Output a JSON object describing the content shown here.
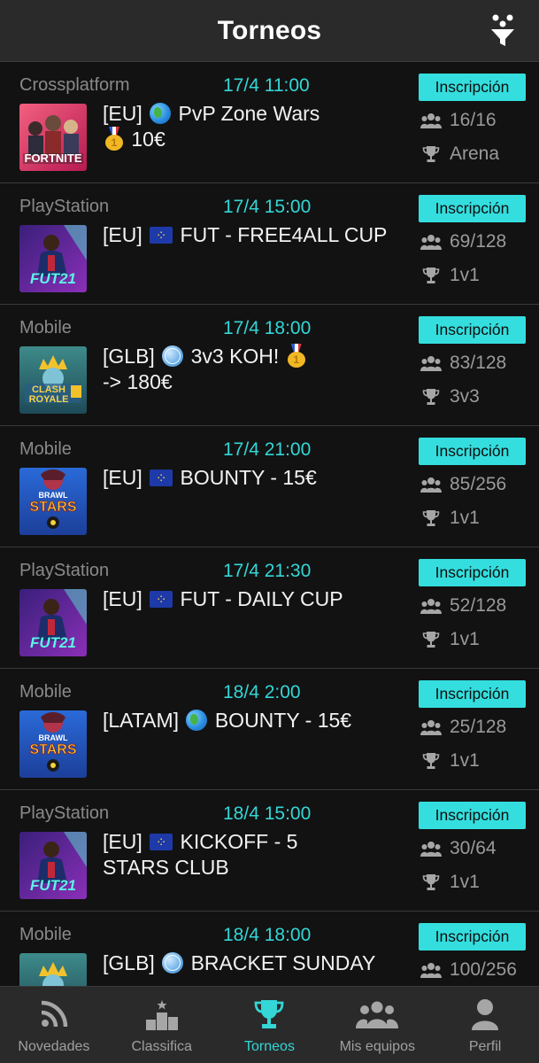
{
  "header": {
    "title": "Torneos"
  },
  "icons": {
    "filter": "filter-funnel-icon",
    "players": "group-icon",
    "format": "trophy-icon"
  },
  "colors": {
    "accent": "#34d6d6",
    "button_bg": "#34dede",
    "background": "#121212",
    "bar": "#2a2a2a"
  },
  "tournaments": [
    {
      "platform": "Crossplatform",
      "date": "17/4 11:00",
      "game": "Fortnite",
      "region": "[EU]",
      "flag": "world",
      "name": "PvP Zone Wars",
      "name2": "10€",
      "medal_end": false,
      "medal_line2": true,
      "button": "Inscripción",
      "players": "16/16",
      "format": "Arena"
    },
    {
      "platform": "PlayStation",
      "date": "17/4 15:00",
      "game": "FUT21",
      "region": "[EU]",
      "flag": "eu",
      "name": "FUT - FREE4ALL CUP",
      "name2": "",
      "medal_end": false,
      "medal_line2": false,
      "button": "Inscripción",
      "players": "69/128",
      "format": "1v1"
    },
    {
      "platform": "Mobile",
      "date": "17/4 18:00",
      "game": "Clash Royale",
      "region": "[GLB]",
      "flag": "grid",
      "name": "3v3 KOH!",
      "name2": "-> 180€",
      "medal_end": true,
      "medal_line2": false,
      "button": "Inscripción",
      "players": "83/128",
      "format": "3v3"
    },
    {
      "platform": "Mobile",
      "date": "17/4 21:00",
      "game": "Brawl Stars",
      "region": "[EU]",
      "flag": "eu",
      "name": "BOUNTY - 15€",
      "name2": "",
      "medal_end": false,
      "medal_line2": false,
      "button": "Inscripción",
      "players": "85/256",
      "format": "1v1"
    },
    {
      "platform": "PlayStation",
      "date": "17/4 21:30",
      "game": "FUT21",
      "region": "[EU]",
      "flag": "eu",
      "name": "FUT - DAILY CUP",
      "name2": "",
      "medal_end": false,
      "medal_line2": false,
      "button": "Inscripción",
      "players": "52/128",
      "format": "1v1"
    },
    {
      "platform": "Mobile",
      "date": "18/4 2:00",
      "game": "Brawl Stars",
      "region": "[LATAM]",
      "flag": "world",
      "name": "BOUNTY - 15€",
      "name2": "",
      "medal_end": false,
      "medal_line2": false,
      "button": "Inscripción",
      "players": "25/128",
      "format": "1v1"
    },
    {
      "platform": "PlayStation",
      "date": "18/4 15:00",
      "game": "FUT21",
      "region": "[EU]",
      "flag": "eu",
      "name": "KICKOFF - 5",
      "name2": "STARS CLUB",
      "medal_end": false,
      "medal_line2": false,
      "button": "Inscripción",
      "players": "30/64",
      "format": "1v1"
    },
    {
      "platform": "Mobile",
      "date": "18/4 18:00",
      "game": "Clash Royale",
      "region": "[GLB]",
      "flag": "grid",
      "name": "BRACKET SUNDAY",
      "name2": "",
      "medal_end": false,
      "medal_line2": false,
      "button": "Inscripción",
      "players": "100/256",
      "format": ""
    }
  ],
  "tabbar": [
    {
      "label": "Novedades",
      "icon": "rss-feed-icon",
      "active": false
    },
    {
      "label": "Classifica",
      "icon": "podium-icon",
      "active": false
    },
    {
      "label": "Torneos",
      "icon": "trophy-icon",
      "active": true
    },
    {
      "label": "Mis equipos",
      "icon": "team-icon",
      "active": false
    },
    {
      "label": "Perfil",
      "icon": "person-icon",
      "active": false
    }
  ]
}
